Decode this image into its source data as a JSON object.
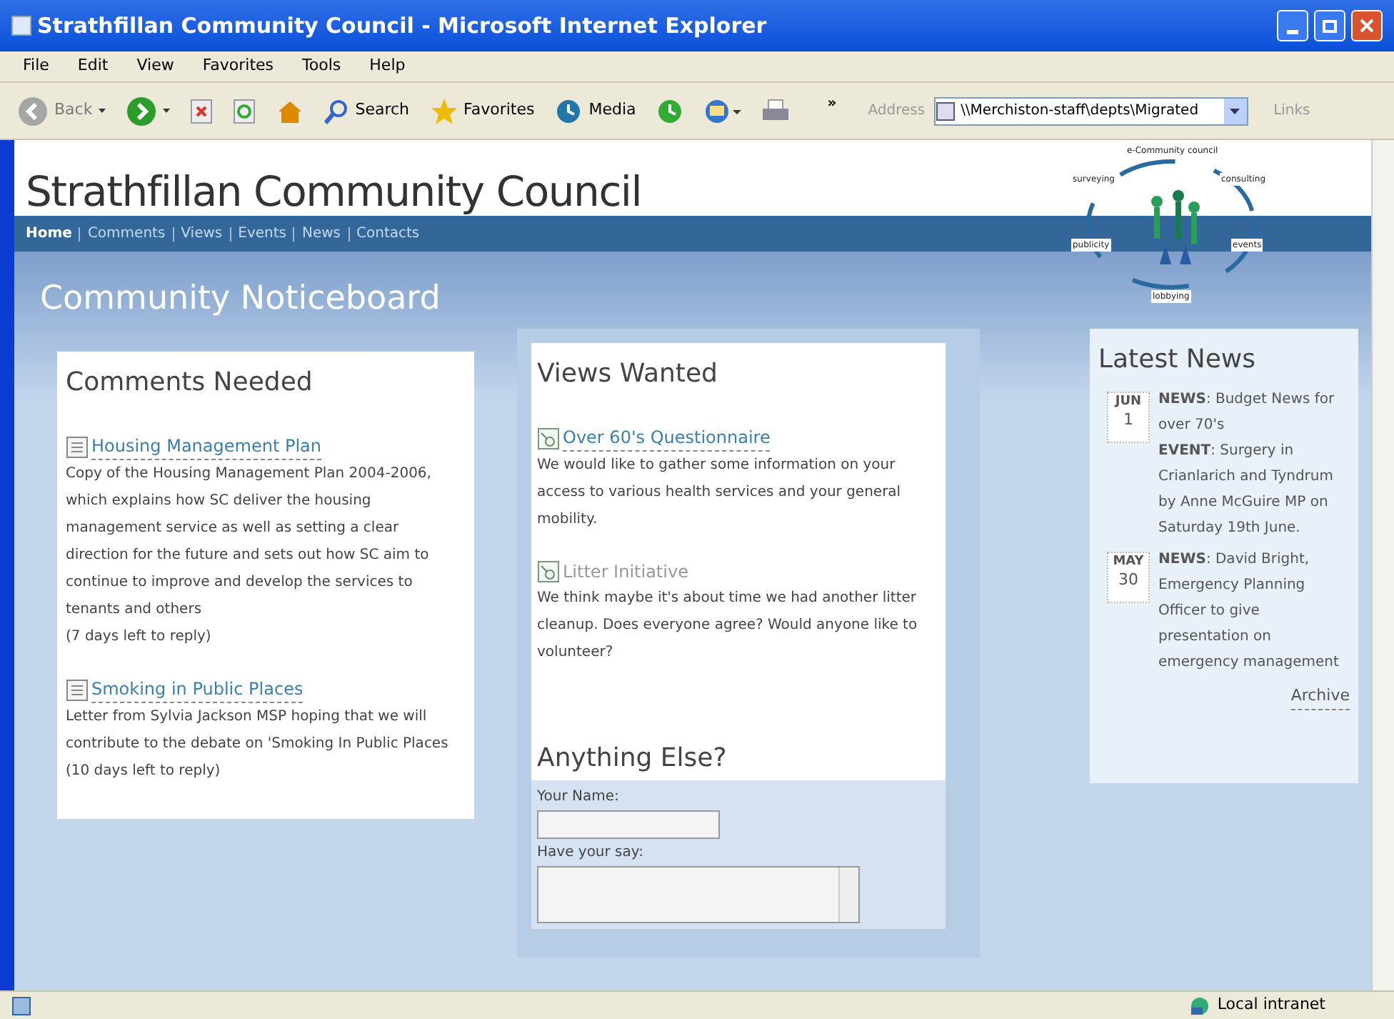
{
  "window": {
    "title": "Strathfillan Community Council - Microsoft Internet Explorer"
  },
  "menu": [
    "File",
    "Edit",
    "View",
    "Favorites",
    "Tools",
    "Help"
  ],
  "toolbar": {
    "buttons": [
      {
        "kind": "back",
        "label": "Back",
        "disabled": true
      },
      {
        "kind": "forward",
        "disabled": false
      },
      {
        "kind": "stop",
        "disabled": false
      },
      {
        "kind": "refresh",
        "disabled": false
      },
      {
        "kind": "home",
        "disabled": false
      },
      {
        "kind": "search",
        "label": "Search",
        "disabled": false
      },
      {
        "kind": "favorites",
        "label": "Favorites",
        "disabled": false
      },
      {
        "kind": "media",
        "label": "Media",
        "disabled": false
      },
      {
        "kind": "history",
        "disabled": false
      },
      {
        "kind": "mail",
        "disabled": false
      },
      {
        "kind": "print",
        "disabled": false
      }
    ],
    "more": "»",
    "address_label": "Address",
    "address": "\\\\Merchiston-staff\\depts\\Migrated",
    "links": "Links"
  },
  "page": {
    "site_title": "Strathfillan Community Council",
    "logo": {
      "title": "e-Community council",
      "labels": [
        "surveying",
        "consulting",
        "publicity",
        "events",
        "lobbying"
      ]
    },
    "nav": [
      {
        "label": "Home",
        "selected": true
      },
      {
        "label": "Comments",
        "selected": false
      },
      {
        "label": "Views",
        "selected": false
      },
      {
        "label": "Events",
        "selected": false
      },
      {
        "label": "News",
        "selected": false
      },
      {
        "label": "Contacts",
        "selected": false
      }
    ],
    "heading": "Community Noticeboard",
    "comments": {
      "heading": "Comments Needed",
      "items": [
        {
          "title": "Housing Management Plan",
          "body": "Copy of the Housing Management Plan 2004-2006, which explains how SC deliver the housing management service as well as setting a clear direction for the future and sets out how SC aim to continue to improve and develop the services to tenants and others",
          "note": "(7 days left to reply)"
        },
        {
          "title": "Smoking in Public Places",
          "body": "Letter from Sylvia Jackson MSP hoping that we will contribute to the debate on 'Smoking In Public Places",
          "note": "(10 days left to reply)"
        }
      ]
    },
    "views": {
      "heading": "Views Wanted",
      "items": [
        {
          "title": "Over 60's Questionnaire",
          "disabled": false,
          "body": "We would like to gather some information on your access to various health services and your general mobility."
        },
        {
          "title": "Litter Initiative",
          "disabled": true,
          "body": "We think maybe it's about time we had another litter cleanup. Does everyone agree? Would anyone like to volunteer?"
        }
      ]
    },
    "anything_else": {
      "heading": "Anything Else?",
      "fields": [
        {
          "kind": "input",
          "label": "Your Name:"
        },
        {
          "kind": "textarea",
          "label": "Have your say:"
        }
      ]
    },
    "news": {
      "heading": "Latest News",
      "items": [
        {
          "month": "JUN",
          "day": "1",
          "entries": [
            "**NEWS**: Budget News for over 70's",
            "**EVENT**: Surgery in Crianlarich and Tyndrum by Anne McGuire MP on Saturday 19th June."
          ]
        },
        {
          "month": "MAY",
          "day": "30",
          "entries": [
            "**NEWS**: David Bright, Emergency Planning Officer to give presentation on emergency management"
          ]
        }
      ],
      "archive": "Archive"
    }
  },
  "status_bar": {
    "zone": "Local intranet"
  }
}
